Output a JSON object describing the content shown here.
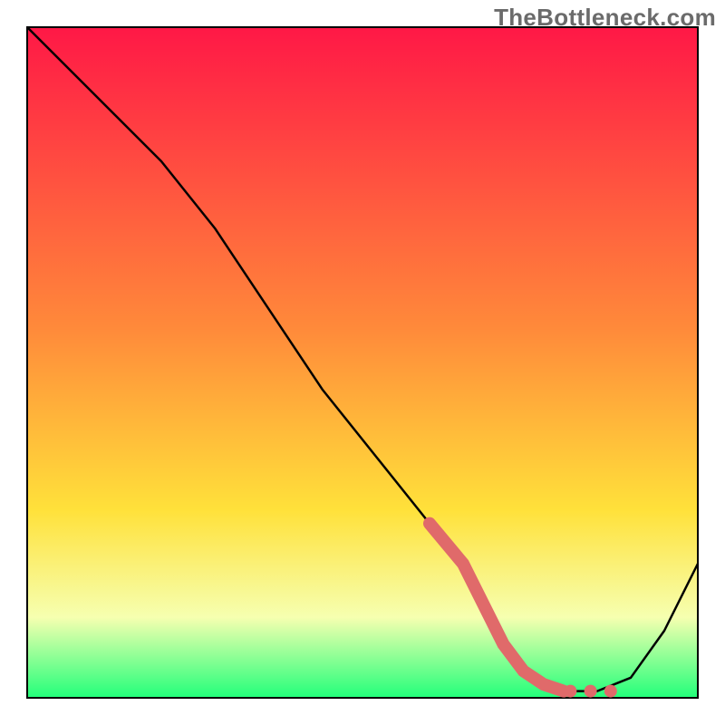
{
  "watermark": "TheBottleneck.com",
  "chart_data": {
    "type": "line",
    "title": "",
    "xlabel": "",
    "ylabel": "",
    "xlim": [
      0,
      100
    ],
    "ylim": [
      0,
      100
    ],
    "grid": false,
    "series": [
      {
        "name": "curve",
        "x": [
          0,
          10,
          20,
          28,
          36,
          44,
          52,
          60,
          65,
          68,
          71,
          74,
          77,
          80,
          85,
          90,
          95,
          100
        ],
        "y": [
          100,
          90,
          80,
          70,
          58,
          46,
          36,
          26,
          20,
          14,
          8,
          4,
          2,
          1,
          1,
          3,
          10,
          20
        ]
      }
    ],
    "highlight": {
      "x": [
        60,
        65,
        68,
        71,
        74,
        77,
        80
      ],
      "y": [
        26,
        20,
        14,
        8,
        4,
        2,
        1
      ]
    },
    "dots": {
      "x": [
        81,
        84,
        87
      ],
      "y": [
        1,
        1,
        1
      ]
    },
    "background_gradient": {
      "top": "#ff1846",
      "mid1": "#ff8a3a",
      "mid2": "#ffe13a",
      "mid3": "#f6ffb0",
      "bottom": "#22ff7a"
    }
  }
}
